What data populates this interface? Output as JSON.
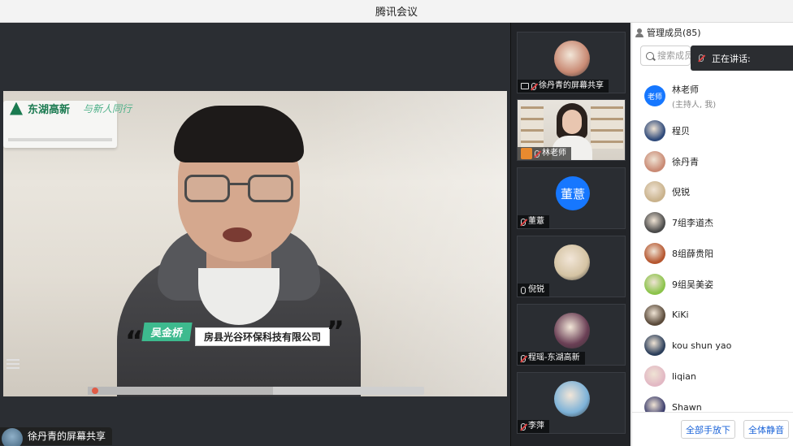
{
  "window": {
    "title": "腾讯会议"
  },
  "main_video": {
    "brand_text": "东湖高新",
    "brand_slogan": "与新人同行",
    "speaker_name": "吴金桥",
    "speaker_company": "房县光谷环保科技有限公司",
    "quote_open": "“",
    "quote_close": "”",
    "share_label": "徐丹青的屏幕共享",
    "progress_fraction": 0.55
  },
  "thumbnails": [
    {
      "label": "徐丹青的屏幕共享",
      "type": "avatar",
      "avatar_color": "#c98a74",
      "icon": "screen-share-icon",
      "mic": "muted"
    },
    {
      "label": "林老师",
      "type": "video",
      "icon": "host-badge-icon",
      "mic": "muted"
    },
    {
      "label": "董薏",
      "type": "initials",
      "initials": "董薏",
      "avatar_color": "#1677ff",
      "mic": "muted"
    },
    {
      "label": "倪锐",
      "type": "avatar",
      "avatar_color": "#d4c3a3",
      "mic": "on"
    },
    {
      "label": "程瑶-东湖高新",
      "type": "avatar",
      "avatar_color": "#6a3f55",
      "mic": "muted"
    },
    {
      "label": "李萍",
      "type": "avatar",
      "avatar_color": "#7db2d8",
      "mic": "muted"
    }
  ],
  "members_panel": {
    "title": "管理成员(85)",
    "search_placeholder": "搜索成员",
    "speaking_label": "正在讲话:",
    "members": [
      {
        "name": "林老师",
        "sub": "(主持人, 我)",
        "avatar_text": "老师",
        "avatar_color": "#1677ff"
      },
      {
        "name": "程贝",
        "avatar_color": "#2f4a7a"
      },
      {
        "name": "徐丹青",
        "avatar_color": "#c98a74"
      },
      {
        "name": "倪锐",
        "avatar_color": "#c9b28c"
      },
      {
        "name": "7组李道杰",
        "avatar_color": "#4a4a4a"
      },
      {
        "name": "8组薛贵阳",
        "avatar_color": "#b5562f"
      },
      {
        "name": "9组吴美姿",
        "avatar_color": "#8bc34a"
      },
      {
        "name": "KiKi",
        "avatar_color": "#5a4a3a"
      },
      {
        "name": "kou shun yao",
        "avatar_color": "#2b3e5a"
      },
      {
        "name": "liqian",
        "avatar_color": "#e2b8c4"
      },
      {
        "name": "Shawn",
        "avatar_color": "#3d3f6e"
      }
    ],
    "buttons": {
      "hands_down": "全部手放下",
      "mute_all": "全体静音"
    }
  }
}
